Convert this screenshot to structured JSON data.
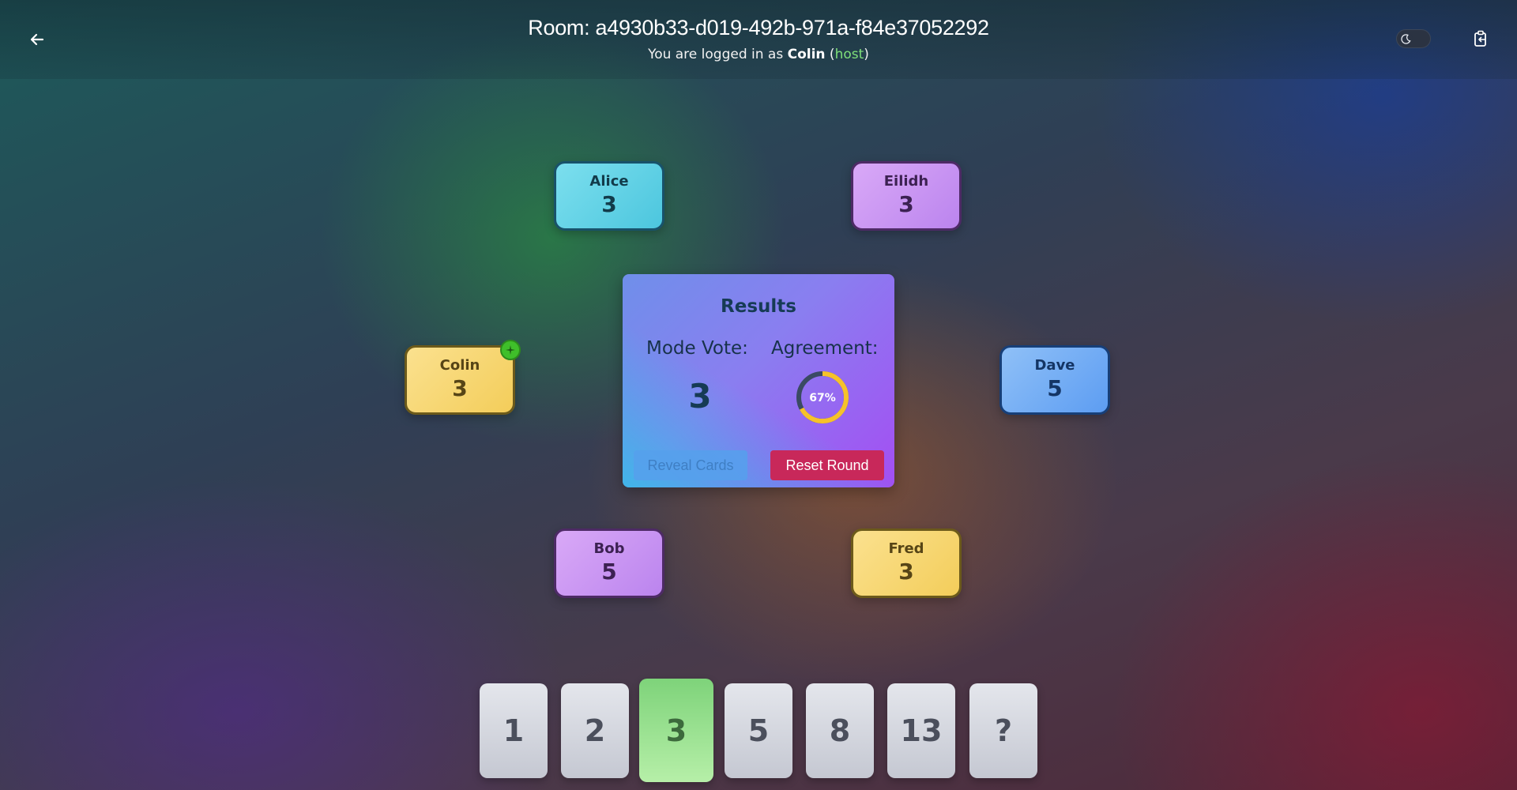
{
  "header": {
    "room_title": "Room: a4930b33-d019-492b-971a-f84e37052292",
    "login_prefix": "You are logged in as ",
    "username": "Colin",
    "role": "host",
    "back_icon": "arrow-left-icon",
    "theme_icon": "moon-icon",
    "copy_icon": "clipboard-copy-icon"
  },
  "players": {
    "alice": {
      "name": "Alice",
      "vote": "3",
      "color": "#4cc6de"
    },
    "eilidh": {
      "name": "Eilidh",
      "vote": "3",
      "color": "#bb84ee"
    },
    "colin": {
      "name": "Colin",
      "vote": "3",
      "color": "#f3cd5a",
      "is_host": true
    },
    "dave": {
      "name": "Dave",
      "vote": "5",
      "color": "#5d9df2"
    },
    "bob": {
      "name": "Bob",
      "vote": "5",
      "color": "#bb84ee"
    },
    "fred": {
      "name": "Fred",
      "vote": "3",
      "color": "#f3cd5a"
    }
  },
  "results": {
    "title": "Results",
    "mode_label": "Mode Vote:",
    "mode_value": "3",
    "agreement_label": "Agreement:",
    "agreement_text": "67%",
    "agreement_fraction": 0.67,
    "reveal_label": "Reveal Cards",
    "reset_label": "Reset Round"
  },
  "deck": {
    "cards": [
      "1",
      "2",
      "3",
      "5",
      "8",
      "13",
      "?"
    ],
    "selected": "3",
    "selected_color": "#7ed37a"
  }
}
